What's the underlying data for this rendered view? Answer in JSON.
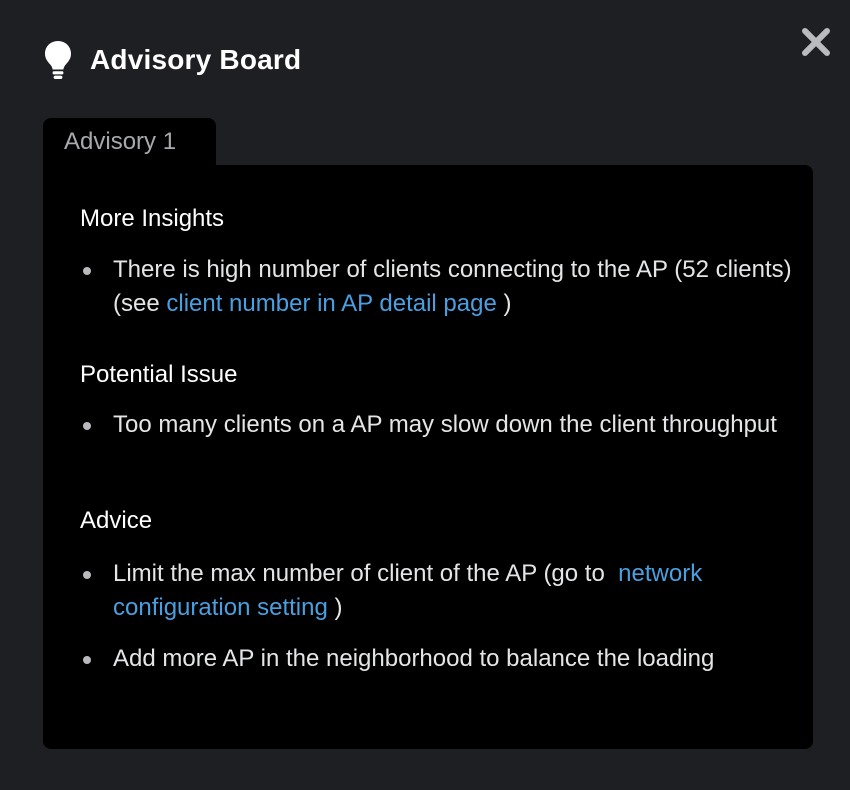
{
  "header": {
    "title": "Advisory Board",
    "icon": "lightbulb-icon",
    "close_icon": "close-icon"
  },
  "tabs": [
    {
      "label": "Advisory 1"
    }
  ],
  "sections": {
    "insights": {
      "title": "More Insights",
      "items": [
        {
          "before": "There is high number of clients connecting to the AP (52 clients) (see ",
          "link": "client number in AP detail page",
          "after": " )"
        }
      ]
    },
    "issue": {
      "title": "Potential Issue",
      "items": [
        {
          "text": "Too many clients on a AP may slow down the client throughput"
        }
      ]
    },
    "advice": {
      "title": "Advice",
      "items": [
        {
          "before": "Limit the max number of client of the AP (go to  ",
          "link": "network configuration setting",
          "after": " )"
        },
        {
          "text": "Add more AP in the neighborhood to balance the loading"
        }
      ]
    }
  },
  "colors": {
    "background": "#1e1f22",
    "panel": "#000000",
    "link": "#4a9fe0",
    "tab_text": "#a7a9ad"
  }
}
